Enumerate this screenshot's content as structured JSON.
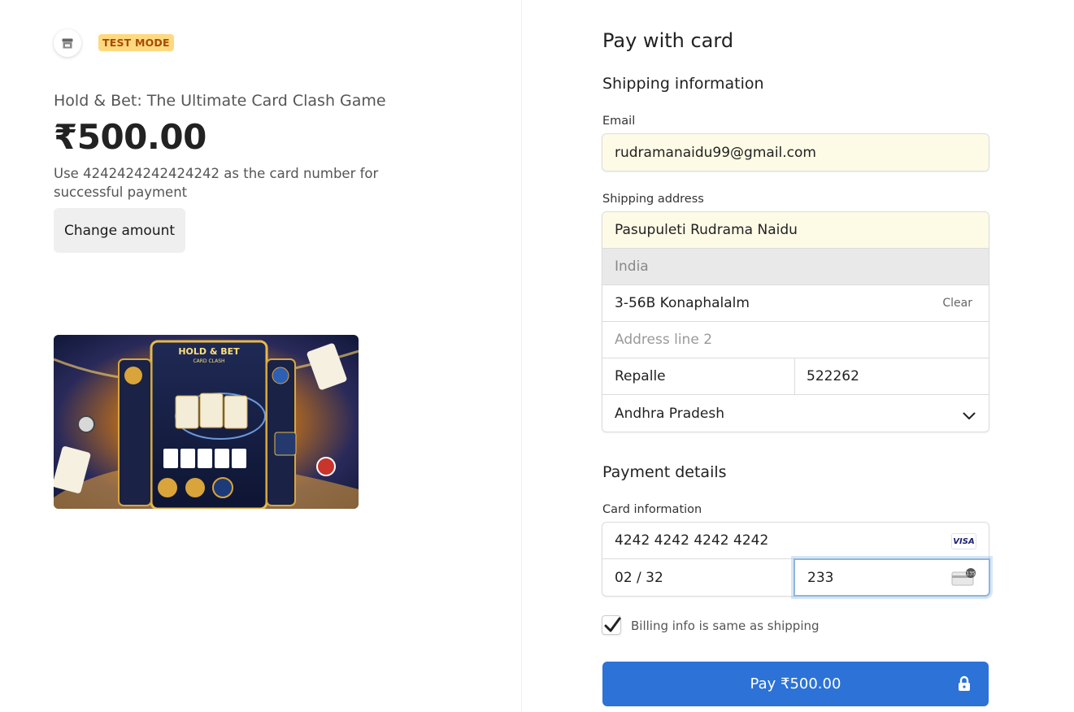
{
  "merchant": {
    "icon": "store-icon",
    "badge": "TEST MODE"
  },
  "product": {
    "name": "Hold & Bet: The Ultimate Card Clash Game",
    "price": "₹500.00",
    "hint": "Use 4242424242424242 as the card number for successful payment",
    "change_amount_label": "Change amount",
    "image_title": "HOLD & BET",
    "image_subtitle": "CARD CLASH"
  },
  "checkout": {
    "title": "Pay with card",
    "shipping_heading": "Shipping information",
    "email_label": "Email",
    "email_value": "rudramanaidu99@gmail.com",
    "address_label": "Shipping address",
    "name_value": "Pasupuleti Rudrama Naidu",
    "country_value": "India",
    "address_line1_value": "3-56B Konaphalalm",
    "clear_label": "Clear",
    "address_line2_placeholder": "Address line 2",
    "city_value": "Repalle",
    "pin_value": "522262",
    "state_value": "Andhra Pradesh",
    "payment_heading": "Payment details",
    "card_label": "Card information",
    "card_number_value": "4242 4242 4242 4242",
    "card_brand": "VISA",
    "expiry_value": "02 / 32",
    "cvc_value": "233",
    "billing_same_label": "Billing info is same as shipping",
    "billing_same_checked": true,
    "pay_label": "Pay ₹500.00"
  },
  "colors": {
    "accent": "#2c72d7",
    "badge_bg": "#ffd980",
    "badge_text": "#a64b00",
    "autofill": "#fdfae6"
  }
}
